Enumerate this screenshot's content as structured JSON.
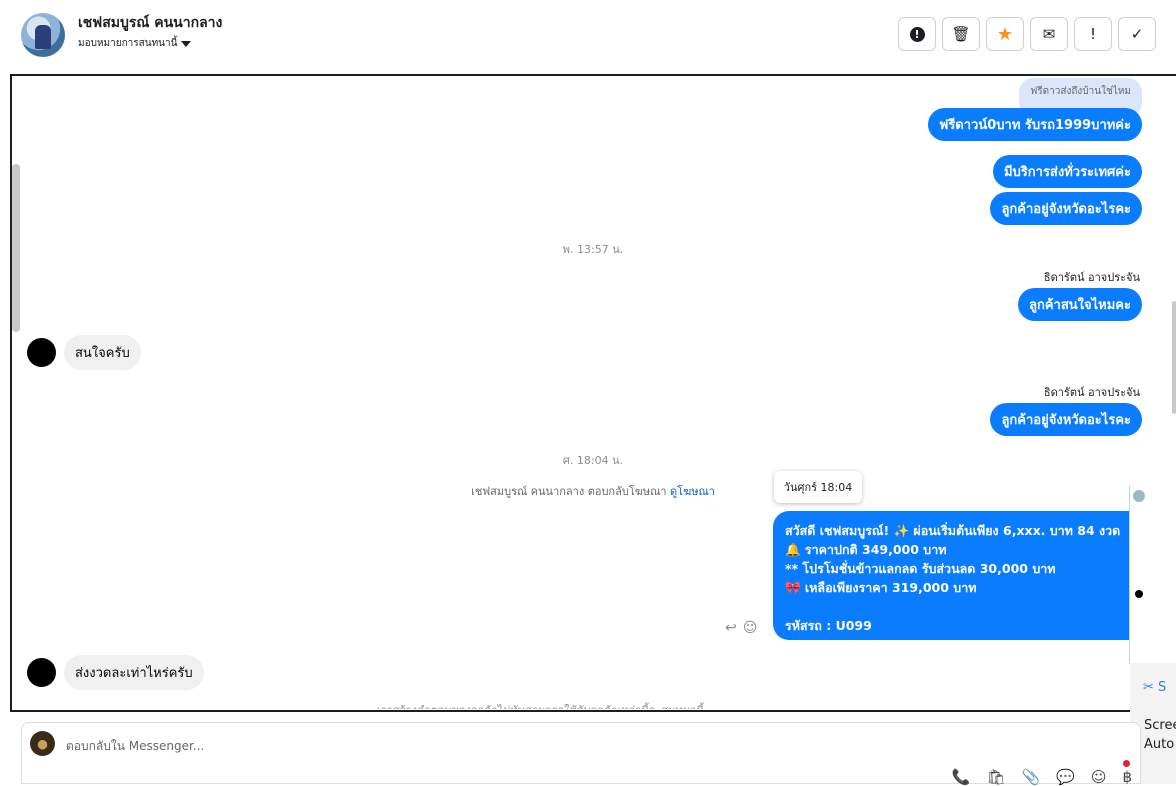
{
  "header": {
    "title": "เชฟสมบูรณ์ คนนากลาง",
    "assign_label": "มอบหมายการสนทนานี้",
    "actions": [
      {
        "name": "spam-button",
        "icon": "!"
      },
      {
        "name": "delete-button",
        "icon": "🗑"
      },
      {
        "name": "star-button",
        "icon": "★"
      },
      {
        "name": "mark-unread-button",
        "icon": "✉"
      },
      {
        "name": "follow-up-button",
        "icon": "!"
      },
      {
        "name": "done-button",
        "icon": "✓"
      }
    ]
  },
  "messages": {
    "reply_ghost": "ฟรีดาวส่งถึงบ้านใช่ไหม",
    "m1": "ฟรีดาวน์0บาท รับรถ1999บาทค่ะ",
    "m2": "มีบริการส่งทั่วระเทศค่ะ",
    "m3": "ลูกค้าอยู่จังหวัดอะไรคะ",
    "time1": "พ. 13:57 น.",
    "sender1": "ธิดารัตน์ อาจประจัน",
    "m4": "ลูกค้าสนใจไหมคะ",
    "in1": "สนใจครับ",
    "sender2": "ธิดารัตน์ อาจประจัน",
    "m5": "ลูกค้าอยู่จังหวัดอะไรคะ",
    "time2": "ศ. 18:04 น.",
    "sys_text": "เชฟสมบูรณ์ คนนากลาง ตอบกลับโฆษณา",
    "sys_link": "ดูโฆษณา",
    "tooltip": "วันศุกร์ 18:04",
    "big_lines": [
      "สวัสดี เชฟสมบูรณ์! ✨  ผ่อนเริ่มต้นเพียง 6,xxx. บาท 84 งวด",
      "🔔 ราคาปกติ 349,000 บาท",
      "** โปรโมชั่นข้าวแลกลด รับส่วนลด 30,000 บาท",
      "🎀  เหลือเพียงราคา 319,000 บาท",
      "",
      " รหัสรถ : U099"
    ],
    "in2": "ส่งงวดละเท่าไหร่ครับ",
    "cut_text": "เราสร้างคำตอบของลูกค้าไม่ทันสามารถใช้กับลูกค้าเหล่านี้จะสนทนานี้"
  },
  "side_panel": {
    "label1": "S",
    "label2": "Scree",
    "label3": "Auto"
  },
  "composer": {
    "placeholder": "ตอบกลับใน Messenger...",
    "tools": [
      "📞",
      "🛍",
      "📎",
      "💬",
      "☺",
      "฿"
    ]
  }
}
